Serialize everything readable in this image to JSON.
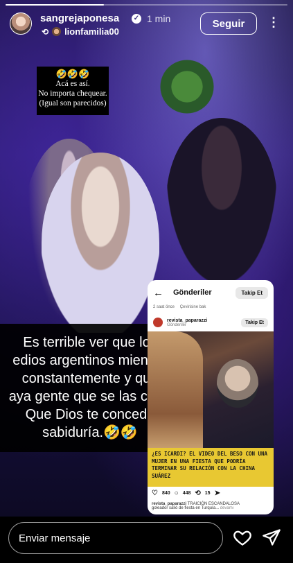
{
  "story": {
    "progress": 0.35,
    "username": "sangrejaponesa",
    "time": "1 min",
    "reposted_from": "lionfamilia00",
    "follow_label": "Seguir"
  },
  "caption_small": {
    "emojis": "🤣🤣🤣",
    "line1": "Acá es así.",
    "line2": "No importa chequear.",
    "line3": "(Igual son parecidos)"
  },
  "caption_big": {
    "line1": "Es terrible ver que los",
    "line2": "edios argentinos mienten",
    "line3": "constantemente y que",
    "line4": "aya gente que se las crea.",
    "line5": "Que Dios te conceda",
    "line6": "sabiduría.🤣🤣"
  },
  "card": {
    "title": "Gönderiler",
    "button": "Takip Et",
    "meta_time": "2 saat önce",
    "meta_translate": "Çevirisine bak",
    "profile_name": "revista_paparazzi",
    "profile_sub": "Gönderiler",
    "profile_follow": "Takip Et",
    "headline": "¿ES ICARDI? EL VIDEO DEL BESO CON UNA MUJER EN UNA FIESTA QUE PODRÍA TERMINAR SU RELACIÓN CON LA CHINA SUÁREZ",
    "likes": "840",
    "comments": "448",
    "reposts": "15",
    "footer_user": "revista_paparazzi",
    "footer_text": "TRAICIÓN ESCANDALOSA",
    "footer_line2": "goleador salió de fiesta en Turquía...",
    "footer_more": "devamı"
  },
  "bottom": {
    "message_placeholder": "Enviar mensaje"
  },
  "icons": {
    "like": "heart-icon",
    "share": "send-icon",
    "menu": "more-icon"
  }
}
